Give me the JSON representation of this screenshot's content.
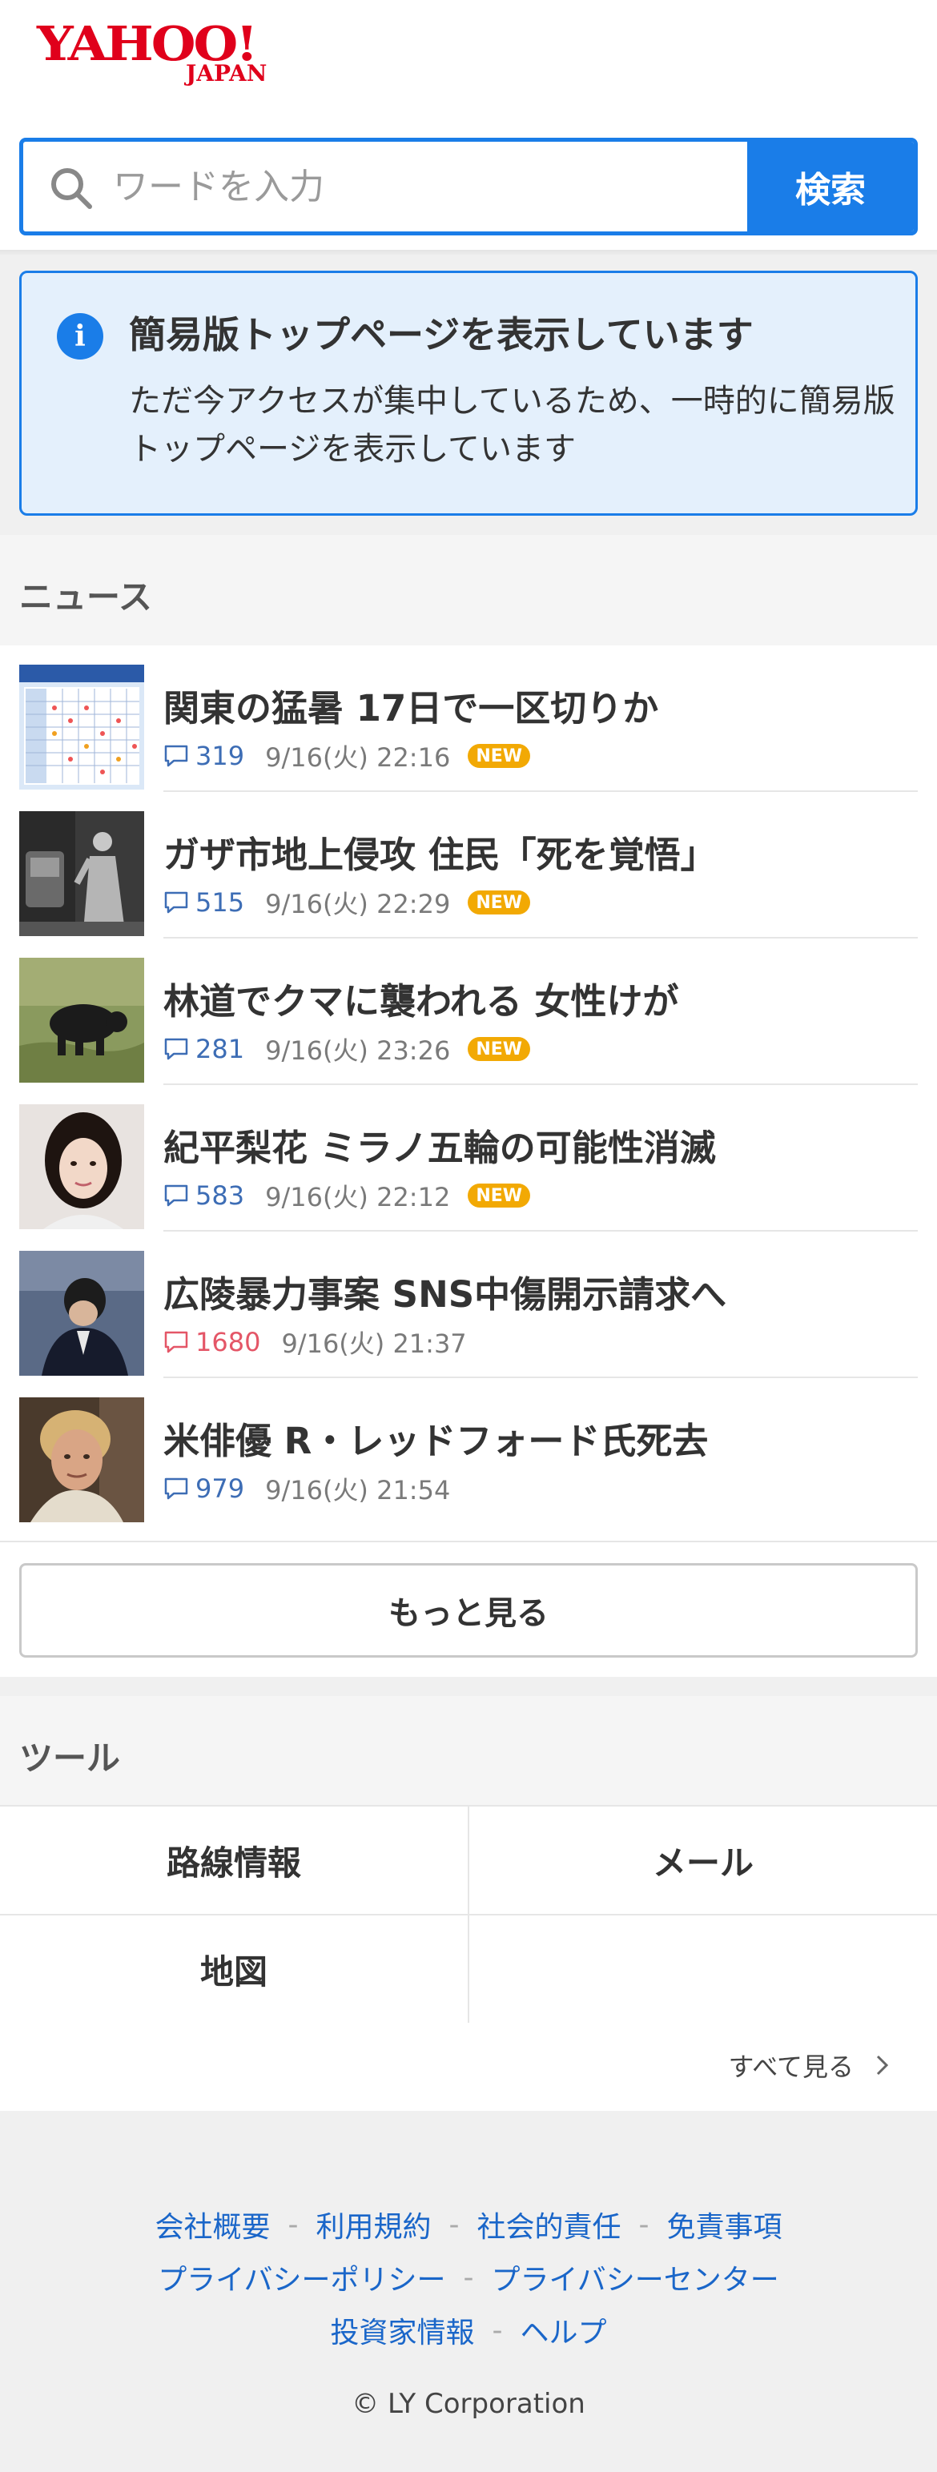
{
  "brand": {
    "logo_main": "YAHOO!",
    "logo_sub": "JAPAN",
    "color": "#e0001b"
  },
  "search": {
    "placeholder": "ワードを入力",
    "value": "",
    "button_label": "検索",
    "accent": "#1a7de8"
  },
  "notice": {
    "icon": "info-icon",
    "title": "簡易版トップページを表示しています",
    "body": "ただ今アクセスが集中しているため、一時的に簡易版トップページを表示しています"
  },
  "news": {
    "section_label": "ニュース",
    "items": [
      {
        "headline": "関東の猛暑 17日で一区切りか",
        "comments": "319",
        "date": "9/16(火) 22:16",
        "badge": "NEW",
        "hot": false
      },
      {
        "headline": "ガザ市地上侵攻 住民「死を覚悟」",
        "comments": "515",
        "date": "9/16(火) 22:29",
        "badge": "NEW",
        "hot": false
      },
      {
        "headline": "林道でクマに襲われる 女性けが",
        "comments": "281",
        "date": "9/16(火) 23:26",
        "badge": "NEW",
        "hot": false
      },
      {
        "headline": "紀平梨花 ミラノ五輪の可能性消滅",
        "comments": "583",
        "date": "9/16(火) 22:12",
        "badge": "NEW",
        "hot": false
      },
      {
        "headline": "広陵暴力事案 SNS中傷開示請求へ",
        "comments": "1680",
        "date": "9/16(火) 21:37",
        "badge": "",
        "hot": true
      },
      {
        "headline": "米俳優 R・レッドフォード氏死去",
        "comments": "979",
        "date": "9/16(火) 21:54",
        "badge": "",
        "hot": false
      }
    ],
    "more_label": "もっと見る"
  },
  "tools": {
    "section_label": "ツール",
    "items": [
      "路線情報",
      "メール",
      "地図",
      ""
    ],
    "see_all_label": "すべて見る"
  },
  "footer": {
    "links_row1": [
      "会社概要",
      "利用規約",
      "社会的責任",
      "免責事項"
    ],
    "links_row2": [
      "プライバシーポリシー",
      "プライバシーセンター"
    ],
    "links_row3": [
      "投資家情報",
      "ヘルプ"
    ],
    "separator": "-",
    "copyright": "© LY Corporation"
  }
}
